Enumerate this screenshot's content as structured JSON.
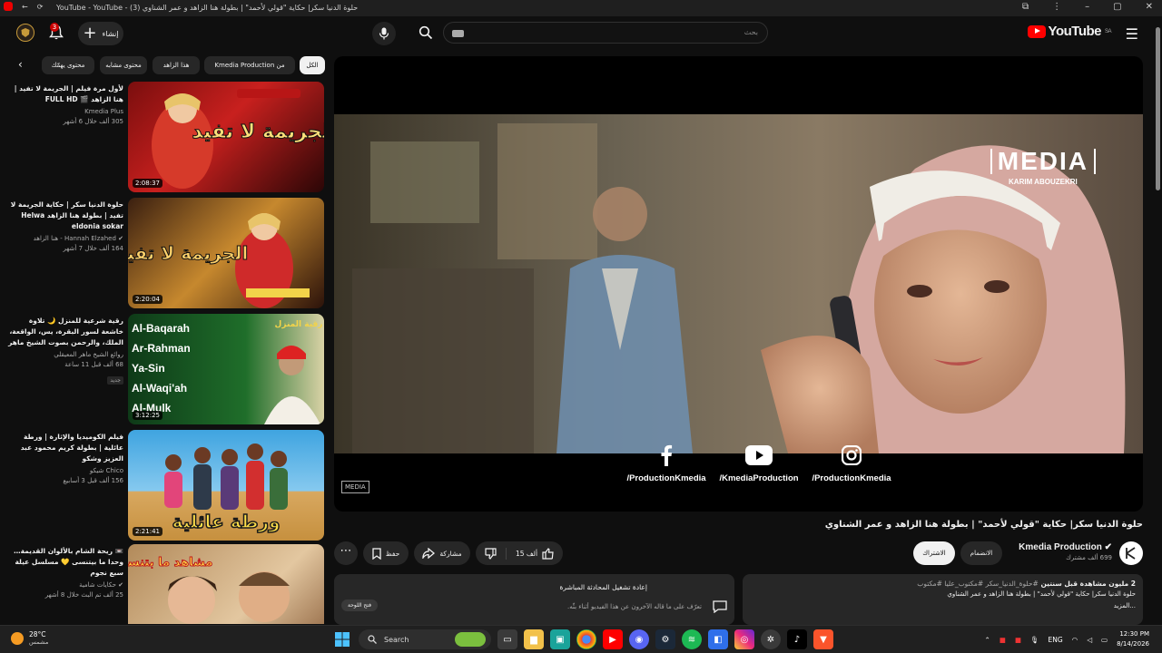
{
  "window": {
    "title": "حلوة الدنيا سكر| حكاية \"قولي لأحمد\" | بطولة هنا الزاهد و عمر الشناوي (3) - YouTube - YouTube"
  },
  "header": {
    "logo_text": "YouTube",
    "logo_region": "SA",
    "search_placeholder": "بحث",
    "create_label": "إنشاء",
    "notifications_count": "3"
  },
  "chips": [
    "الكل",
    "من Kmedia Production",
    "هذا الزاهد",
    "محتوى مشابه",
    "محتوى يهمّك"
  ],
  "related": [
    {
      "title": "لأول مرة فيلم | الجريمة لا تفيد | هنا الزاهد 🎬 FULL HD",
      "channel": "Kmedia Plus",
      "meta": "305 ألف  خلال 6 أشهر",
      "duration": "2:08:37",
      "badge": "",
      "thumb_text": "الجريمة لا تفيد"
    },
    {
      "title": "حلوة الدنيا سكر | حكاية الجريمة لا تفيد | بطولة هنا الزاهد Helwa eldonia sokar",
      "channel": "Hannah Elzahed - هنا الزاهد",
      "meta": "164 ألف  خلال 7 أشهر",
      "duration": "2:20:04",
      "badge": "",
      "thumb_text": "الجريمة لا تفيد"
    },
    {
      "title": "رقية شرعية للمنزل 🌙 تلاوة خاشعة لسور البقرة، يس، الواقعة، الملك، والرحمن بصوت الشيخ ماهر المعيقلي 🌹",
      "channel": "روائع الشيخ ماهر المعيقلي",
      "meta": "68 ألف  قبل 11 ساعة",
      "duration": "3:12:25",
      "badge": "جديد",
      "thumb_text": "رقية المنزل"
    },
    {
      "title": "فيلم الكوميديا والإثارة | ورطة عائلية | بطولة كريم محمود عبد العزيز وشكو",
      "channel": "Chico شيكو",
      "meta": "156 ألف  قبل 3 أسابيع",
      "duration": "2:21:41",
      "badge": "",
      "thumb_text": "ورطة عائلية"
    },
    {
      "title": "📼 ريحة الشام بالألوان القديمة… وحدا ما بيتنسى 💛 مسلسل عيلة سبع نجوم",
      "channel": "حكايات شامية",
      "meta": "25 ألف  تم البث خلال 8 أشهر",
      "duration": "",
      "badge": "",
      "thumb_text": "مشاهد ما بتنسى"
    }
  ],
  "player": {
    "watermark_title": "MEDIA",
    "watermark_sub": "KARIM ABOUZEKRI",
    "corner_mark": "MEDIA",
    "socials": [
      {
        "name": "facebook",
        "handle": "/ProductionKmedia"
      },
      {
        "name": "youtube",
        "handle": "/KmediaProduction"
      },
      {
        "name": "instagram",
        "handle": "/ProductionKmedia"
      }
    ]
  },
  "video": {
    "title": "حلوة الدنيا سكر| حكاية \"قولي لأحمد\" | بطولة هنا الزاهد و عمر الشناوي",
    "channel_name": "Kmedia Production",
    "subscribers": "699 ألف مشترك",
    "join_label": "الانضمام",
    "subscribe_label": "الاشتراك",
    "likes": "15 ألف",
    "share_label": "مشاركة",
    "save_label": "حفظ"
  },
  "description": {
    "stats": "2 مليون مشاهدة  قبل سنتين",
    "tags": "#حلوة_الدنيا_سكر #مكتوب_عليا #مكتوب",
    "text": "حلوة الدنيا سكر| حكاية \"قولي لأحمد\" | بطولة هنا الزاهد و عمر الشناوي",
    "more": "...المزيد"
  },
  "live_chat": {
    "title": "إعادة تشغيل المحادثة المباشرة",
    "desc": "تعرّف على ما قاله الآخرون عن هذا الفيديو أثناء بثّه.",
    "open_label": "فتح اللوحة"
  },
  "taskbar": {
    "temperature": "28°C",
    "weather_desc": "مشمس",
    "search_label": "Search",
    "language": "ENG",
    "time": "12:30 PM",
    "date": "8/14/2026"
  },
  "colors": {
    "bg": "#0f0f0f",
    "panel": "#272727",
    "brand_red": "#ff0000",
    "text": "#f1f1f1",
    "muted": "#aaaaaa"
  }
}
